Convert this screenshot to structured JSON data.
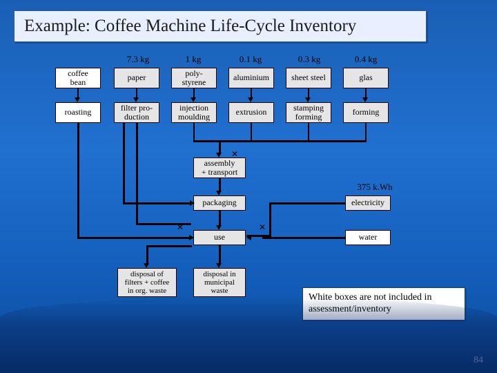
{
  "title": "Example: Coffee Machine Life-Cycle Inventory",
  "masses": {
    "paper": "7.3 kg",
    "polystyrene": "1 kg",
    "aluminium": "0.1 kg",
    "sheet_steel": "0.3 kg",
    "glas": "0.4 kg",
    "electricity": "375 k.Wh"
  },
  "boxes": {
    "coffee_bean": "coffee\nbean",
    "paper": "paper",
    "polystyrene": "poly-\nstyrene",
    "aluminium": "aluminium",
    "sheet_steel": "sheet steel",
    "glas": "glas",
    "roasting": "roasting",
    "filter_prod": "filter pro-\nduction",
    "injection": "injection\nmoulding",
    "extrusion": "extrusion",
    "stamping": "stamping\nforming",
    "forming": "forming",
    "assembly": "assembly\n+ transport",
    "packaging": "packaging",
    "electricity": "electricity",
    "use": "use",
    "water": "water",
    "disposal_org": "disposal of\nfilters + coffee\nin org. waste",
    "disposal_mun": "disposal in\nmunicipal\nwaste"
  },
  "note": "White boxes are not included in assessment/inventory",
  "page": "84"
}
